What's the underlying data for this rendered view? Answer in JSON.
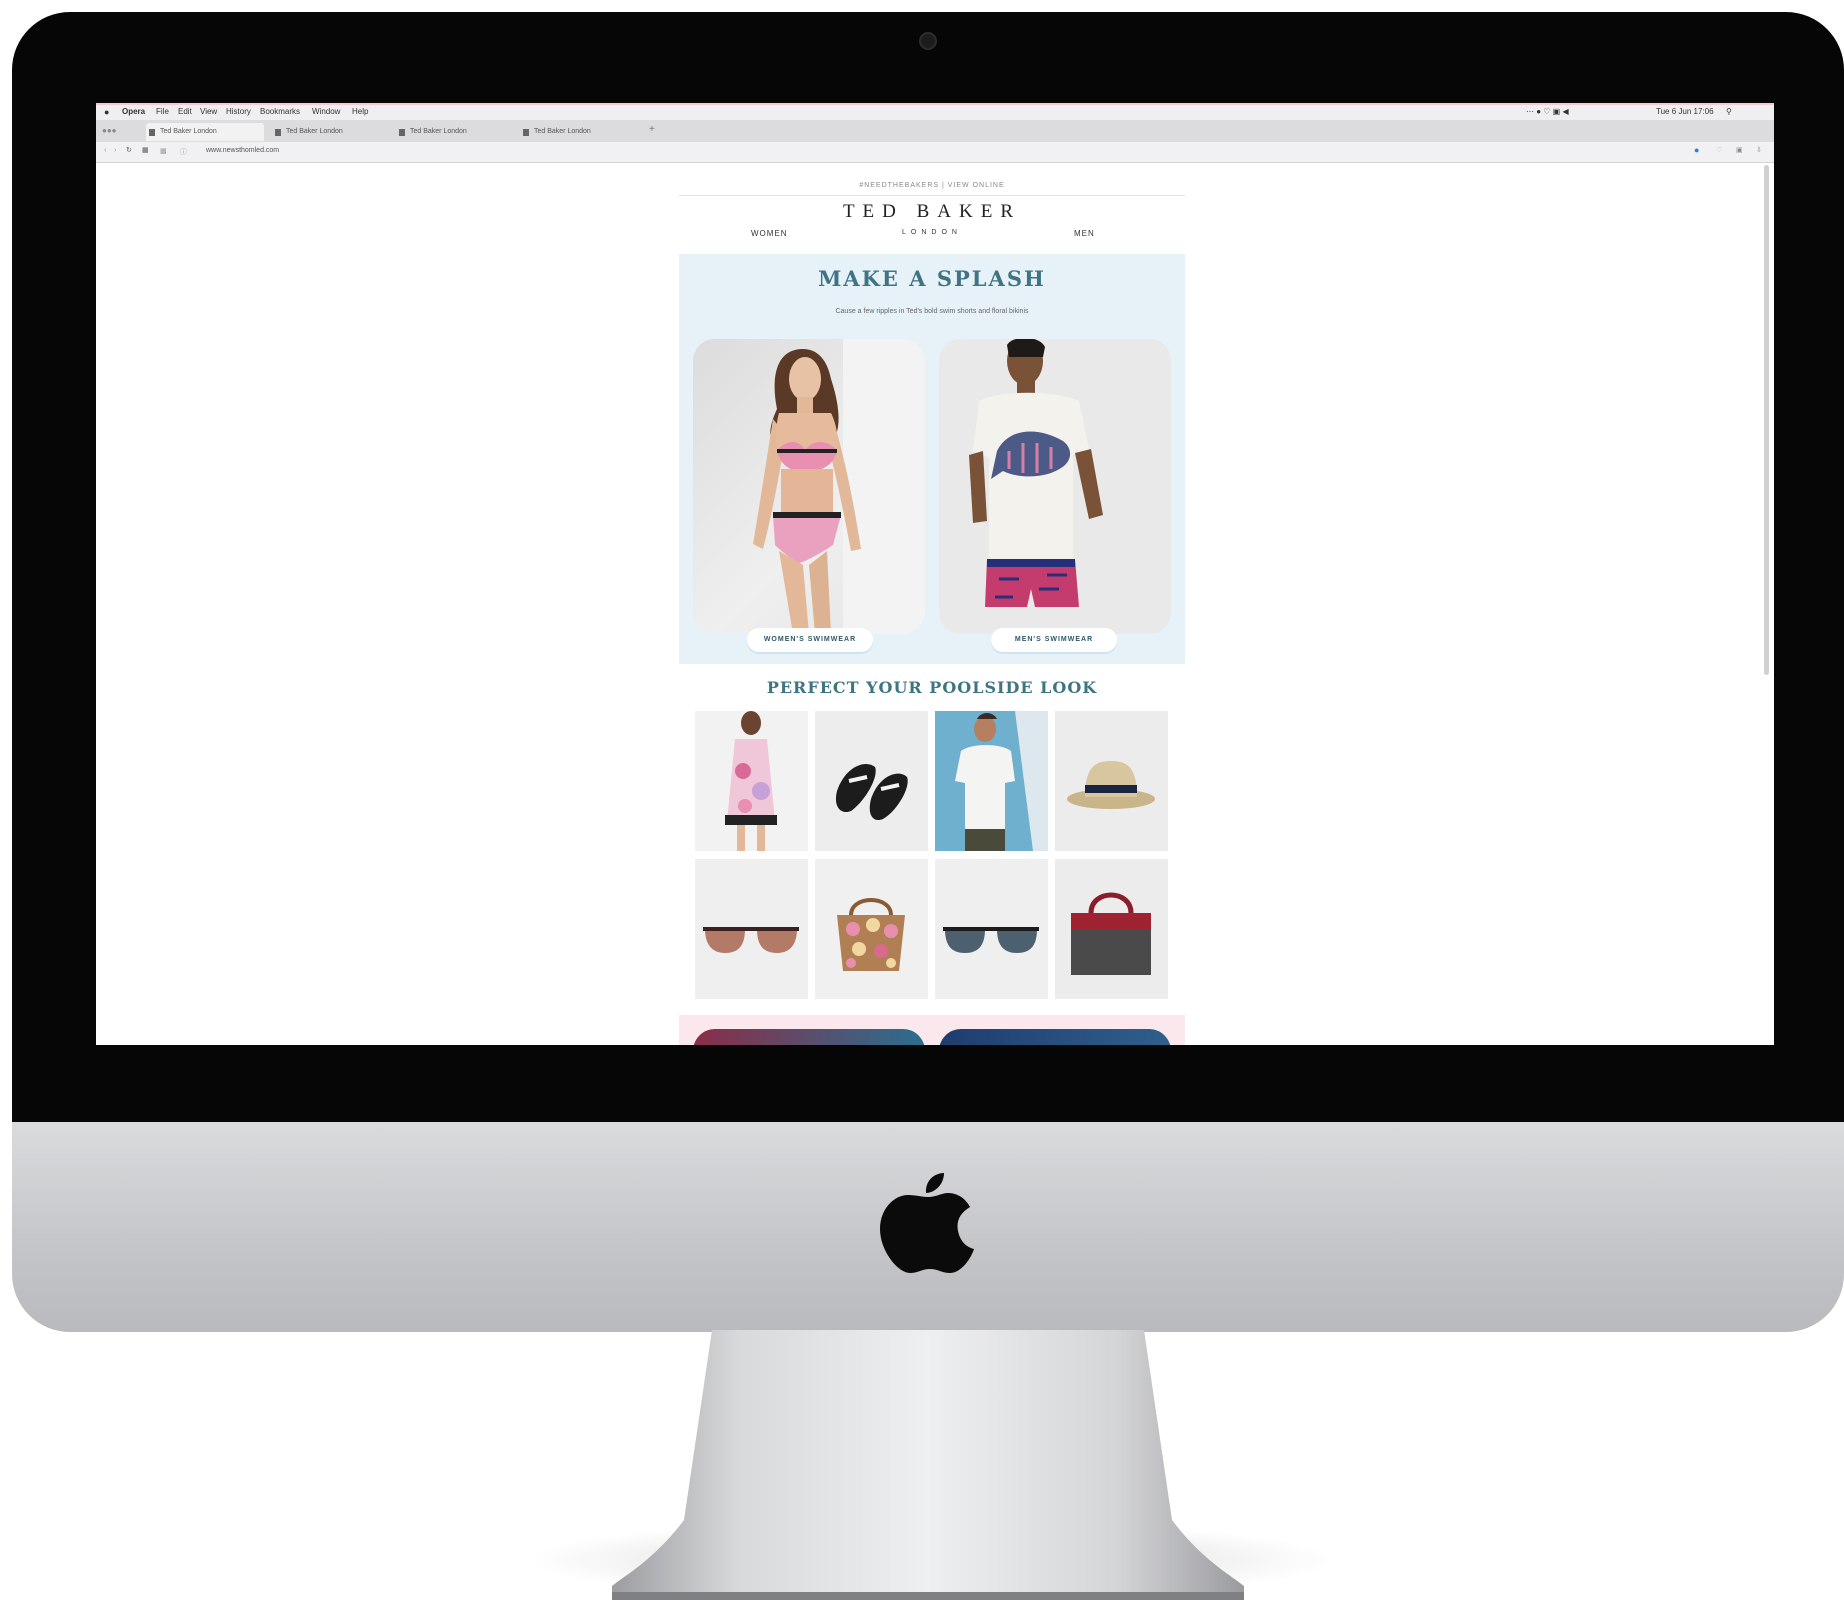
{
  "menubar": {
    "app": "Opera",
    "items": [
      "File",
      "Edit",
      "View",
      "History",
      "Bookmarks",
      "Window",
      "Help"
    ],
    "clock": "Tue 6 Jun 17:06"
  },
  "tabs": [
    "Ted Baker London",
    "Ted Baker London",
    "Ted Baker London",
    "Ted Baker London"
  ],
  "address": {
    "url": "www.newsthomled.com"
  },
  "email": {
    "preheader": "#NEEDTHEBAKERS | VIEW ONLINE",
    "brand": "TED BAKER",
    "brand_sub": "LONDON",
    "nav_women": "WOMEN",
    "nav_men": "MEN",
    "hero_title": "MAKE A SPLASH",
    "hero_subtitle": "Cause a few ripples in Ted's bold swim shorts and floral bikinis",
    "womens_button": "WOMEN'S SWIMWEAR",
    "mens_button": "MEN'S SWIMWEAR",
    "section_title": "PERFECT YOUR POOLSIDE LOOK",
    "products": [
      "floral-dress",
      "black-sandals",
      "white-polo",
      "straw-hat",
      "brown-sunglasses",
      "pompom-tote",
      "grey-sunglasses",
      "two-tone-handbag"
    ]
  },
  "colors": {
    "accent": "#3f7483",
    "hero_bg": "#e6f2f8",
    "bottom_band": "#fbe8ec"
  }
}
